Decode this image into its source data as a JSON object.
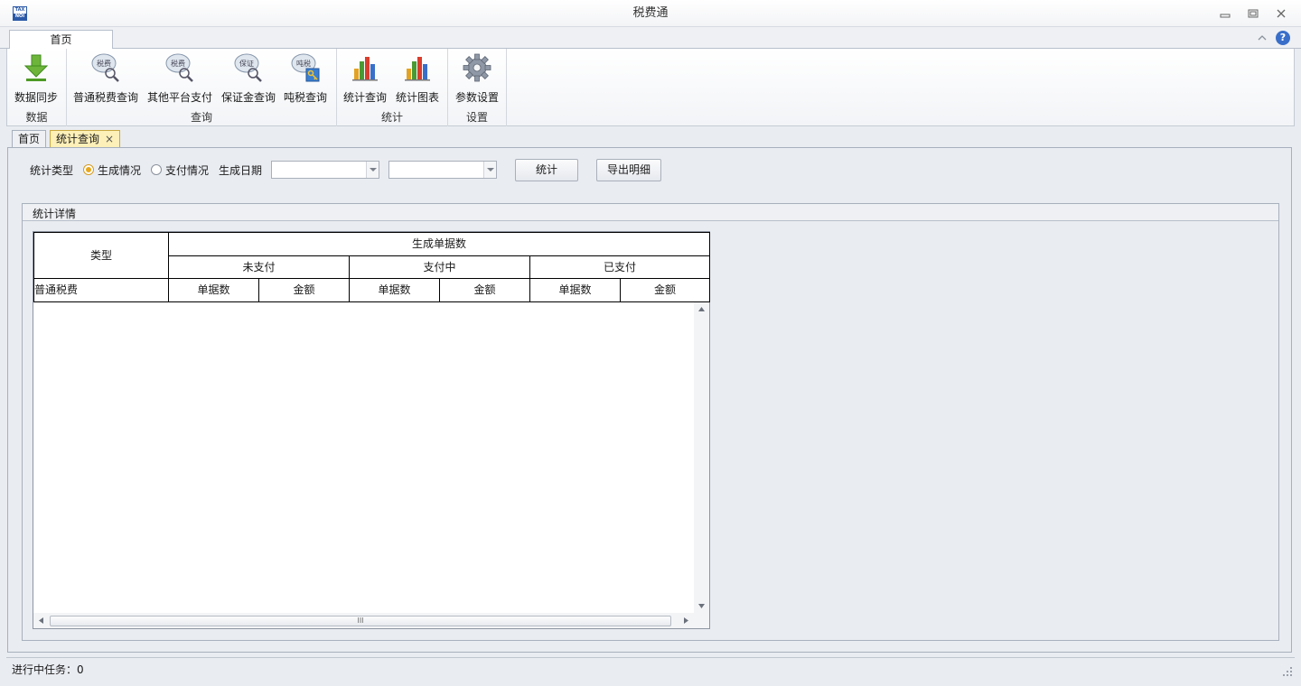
{
  "window": {
    "title": "税费通",
    "logo_text_top": "TAX",
    "logo_text_bottom": "NOI"
  },
  "ribbon": {
    "tabs": [
      "首页"
    ],
    "groups": [
      {
        "label": "数据",
        "buttons": [
          {
            "label": "数据同步",
            "icon": "download-arrow-icon"
          }
        ]
      },
      {
        "label": "查询",
        "buttons": [
          {
            "label": "普通税费查询",
            "icon": "tax-search-icon",
            "badge": "税费"
          },
          {
            "label": "其他平台支付",
            "icon": "tax-search-icon",
            "badge": "税费"
          },
          {
            "label": "保证金查询",
            "icon": "deposit-search-icon",
            "badge": "保证"
          },
          {
            "label": "吨税查询",
            "icon": "tonnage-key-icon",
            "badge": "吨税"
          }
        ]
      },
      {
        "label": "统计",
        "buttons": [
          {
            "label": "统计查询",
            "icon": "bar-chart-icon"
          },
          {
            "label": "统计图表",
            "icon": "bar-chart-icon"
          }
        ]
      },
      {
        "label": "设置",
        "buttons": [
          {
            "label": "参数设置",
            "icon": "gear-icon"
          }
        ]
      }
    ]
  },
  "doc_tabs": [
    {
      "label": "首页",
      "active": false
    },
    {
      "label": "统计查询",
      "active": true,
      "close": "×"
    }
  ],
  "filter": {
    "type_label": "统计类型",
    "options": [
      {
        "label": "生成情况",
        "checked": true
      },
      {
        "label": "支付情况",
        "checked": false
      }
    ],
    "date_label": "生成日期",
    "date_from": "",
    "date_to": "",
    "stat_button": "统计",
    "export_button": "导出明细"
  },
  "details": {
    "title": "统计详情",
    "header": {
      "type": "类型",
      "group": "生成单据数",
      "subgroups": [
        "未支付",
        "支付中",
        "已支付"
      ],
      "first_row_label": "普通税费",
      "leaf_columns": [
        "单据数",
        "金额",
        "单据数",
        "金额",
        "单据数",
        "金额"
      ]
    },
    "hscroll_grip": "III"
  },
  "status": {
    "text": "进行中任务：0"
  },
  "colors": {
    "accent_radio": "#e8a81e",
    "active_tab_bg": "#fdf0b8",
    "help_blue": "#3a6fc9"
  }
}
